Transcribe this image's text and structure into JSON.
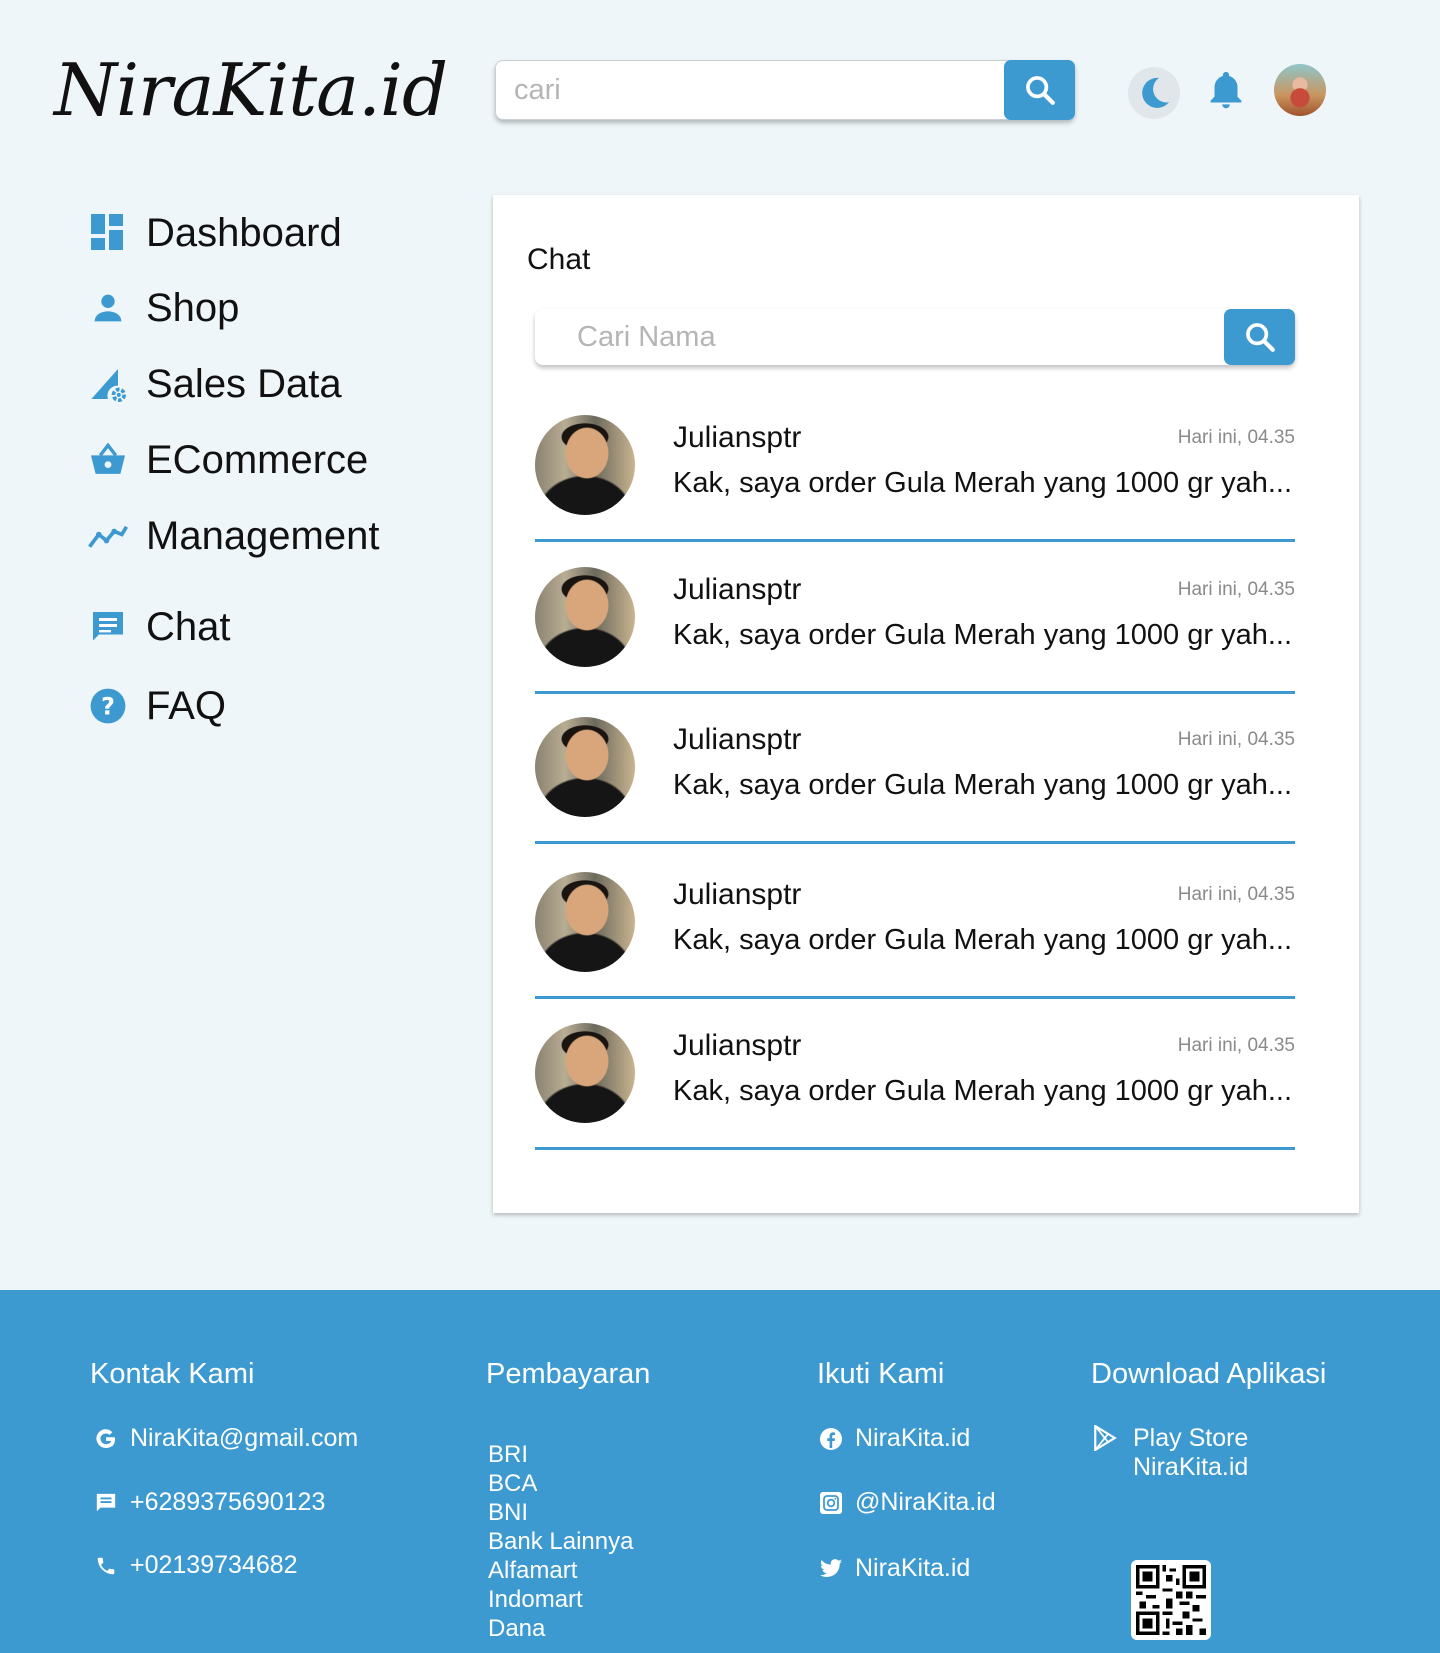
{
  "logo": "NiraKita.id",
  "header": {
    "search_placeholder": "cari",
    "search_icon": "search-icon",
    "theme_icon": "moon-icon",
    "notification_icon": "bell-icon"
  },
  "sidebar": {
    "items": [
      {
        "label": "Dashboard",
        "icon": "dashboard-icon"
      },
      {
        "label": "Shop",
        "icon": "person-icon"
      },
      {
        "label": "Sales Data",
        "icon": "sales-data-icon"
      },
      {
        "label": "ECommerce",
        "icon": "basket-icon"
      },
      {
        "label": "Management",
        "icon": "trend-icon"
      },
      {
        "label": "Chat",
        "icon": "chat-icon"
      },
      {
        "label": "FAQ",
        "icon": "help-icon"
      }
    ]
  },
  "chat_panel": {
    "title": "Chat",
    "search_placeholder": "Cari Nama",
    "conversations": [
      {
        "name": "Juliansptr",
        "time": "Hari ini, 04.35",
        "message": "Kak, saya order Gula Merah yang 1000 gr yah..."
      },
      {
        "name": "Juliansptr",
        "time": "Hari ini, 04.35",
        "message": "Kak, saya order Gula Merah yang 1000 gr yah..."
      },
      {
        "name": "Juliansptr",
        "time": "Hari ini, 04.35",
        "message": "Kak, saya order Gula Merah yang 1000 gr yah..."
      },
      {
        "name": "Juliansptr",
        "time": "Hari ini, 04.35",
        "message": "Kak, saya order Gula Merah yang 1000 gr yah..."
      },
      {
        "name": "Juliansptr",
        "time": "Hari ini, 04.35",
        "message": "Kak, saya order Gula Merah yang 1000 gr yah..."
      }
    ]
  },
  "footer": {
    "contact": {
      "title": "Kontak Kami",
      "email": "NiraKita@gmail.com",
      "whatsapp": "+6289375690123",
      "phone": "+02139734682"
    },
    "payment": {
      "title": "Pembayaran",
      "methods": [
        "BRI",
        "BCA",
        "BNI",
        "Bank Lainnya",
        "Alfamart",
        "Indomart",
        "Dana"
      ]
    },
    "social": {
      "title": "Ikuti Kami",
      "facebook": "NiraKita.id",
      "instagram": "@NiraKita.id",
      "twitter": "NiraKita.id"
    },
    "download": {
      "title": "Download Aplikasi",
      "store": "Play Store",
      "app_name": "NiraKita.id"
    }
  },
  "colors": {
    "accent": "#3d9ad1",
    "background": "#eef6f9",
    "panel": "#ffffff"
  }
}
